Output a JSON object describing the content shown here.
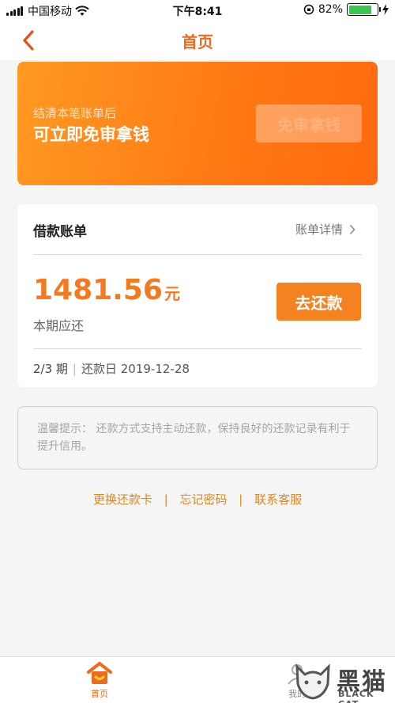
{
  "status_bar": {
    "carrier": "中国移动",
    "time": "下午8:41",
    "battery": "82%",
    "battery_level": 0.82
  },
  "nav": {
    "title": "首页"
  },
  "promo": {
    "subtitle": "结清本笔账单后",
    "headline": "可立即免审拿钱",
    "button": "免审拿钱"
  },
  "bill": {
    "title": "借款账单",
    "detail_link": "账单详情",
    "amount": "1481.56",
    "amount_unit": "元",
    "amount_label": "本期应还",
    "repay_button": "去还款",
    "period": "2/3 期",
    "separator": "|",
    "due_date": "还款日 2019-12-28"
  },
  "tip": {
    "text": "温馨提示： 还款方式支持主动还款，保持良好的还款记录有利于提升信用。"
  },
  "links": {
    "change_card": "更换还款卡",
    "forgot_password": "忘记密码",
    "contact_service": "联系客服",
    "separator": "|"
  },
  "tabbar": {
    "home": "首页",
    "mine": "我的"
  },
  "watermark": {
    "text": "黑猫",
    "sub": "BLACK CAT"
  },
  "colors": {
    "accent": "#f06a1e",
    "orange_button": "#f58220",
    "amount": "#f47a20"
  }
}
